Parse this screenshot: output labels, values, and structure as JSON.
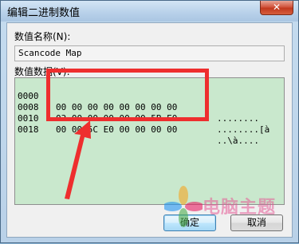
{
  "window": {
    "title": "编辑二进制数值",
    "close_glyph": "✕"
  },
  "value_name": {
    "label": "数值名称(N):",
    "value": "Scancode Map"
  },
  "value_data": {
    "label": "数值数据(V):",
    "rows": [
      {
        "offset": "0000",
        "bytes": "00 00 00 00 00 00 00 00",
        "ascii": "........"
      },
      {
        "offset": "0008",
        "bytes": "03 00 00 00 00 00 5B E0",
        "ascii": "........[à"
      },
      {
        "offset": "0010",
        "bytes": "00 00 5C E0 00 00 00 00",
        "ascii": "..\\à...."
      },
      {
        "offset": "0018",
        "bytes": "",
        "ascii": ""
      }
    ]
  },
  "buttons": {
    "ok": "确定",
    "cancel": "取消"
  },
  "watermark": {
    "text": "电脑主题"
  },
  "colors": {
    "annotation_red": "#ee2e2e",
    "hex_bg": "#c9e8cd"
  }
}
